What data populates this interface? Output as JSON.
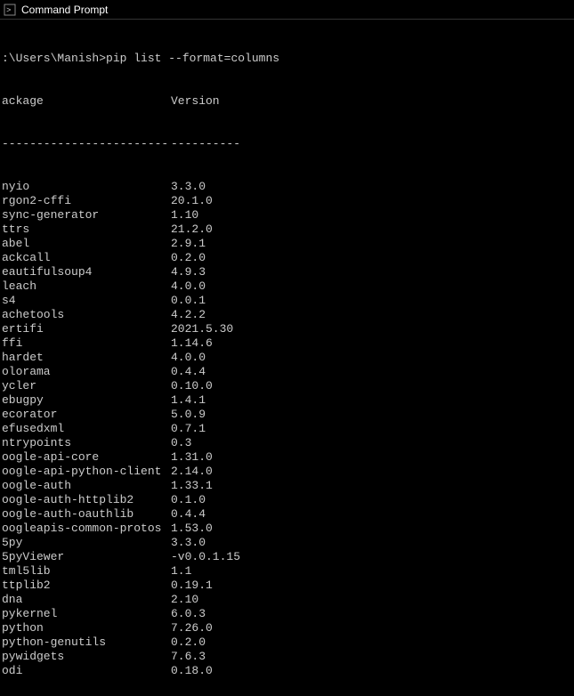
{
  "window": {
    "title": "Command Prompt"
  },
  "prompt": {
    "path": ":\\Users\\Manish>",
    "command": "pip list --format=columns"
  },
  "headers": {
    "package": "ackage",
    "version": "Version"
  },
  "separators": {
    "package": "------------------------",
    "version": "----------"
  },
  "packages": [
    {
      "name": "nyio",
      "version": "3.3.0"
    },
    {
      "name": "rgon2-cffi",
      "version": "20.1.0"
    },
    {
      "name": "sync-generator",
      "version": "1.10"
    },
    {
      "name": "ttrs",
      "version": "21.2.0"
    },
    {
      "name": "abel",
      "version": "2.9.1"
    },
    {
      "name": "ackcall",
      "version": "0.2.0"
    },
    {
      "name": "eautifulsoup4",
      "version": "4.9.3"
    },
    {
      "name": "leach",
      "version": "4.0.0"
    },
    {
      "name": "s4",
      "version": "0.0.1"
    },
    {
      "name": "achetools",
      "version": "4.2.2"
    },
    {
      "name": "ertifi",
      "version": "2021.5.30"
    },
    {
      "name": "ffi",
      "version": "1.14.6"
    },
    {
      "name": "hardet",
      "version": "4.0.0"
    },
    {
      "name": "olorama",
      "version": "0.4.4"
    },
    {
      "name": "ycler",
      "version": "0.10.0"
    },
    {
      "name": "ebugpy",
      "version": "1.4.1"
    },
    {
      "name": "ecorator",
      "version": "5.0.9"
    },
    {
      "name": "efusedxml",
      "version": "0.7.1"
    },
    {
      "name": "ntrypoints",
      "version": "0.3"
    },
    {
      "name": "oogle-api-core",
      "version": "1.31.0"
    },
    {
      "name": "oogle-api-python-client",
      "version": "2.14.0"
    },
    {
      "name": "oogle-auth",
      "version": "1.33.1"
    },
    {
      "name": "oogle-auth-httplib2",
      "version": "0.1.0"
    },
    {
      "name": "oogle-auth-oauthlib",
      "version": "0.4.4"
    },
    {
      "name": "oogleapis-common-protos",
      "version": "1.53.0"
    },
    {
      "name": "5py",
      "version": "3.3.0"
    },
    {
      "name": "5pyViewer",
      "version": "-v0.0.1.15"
    },
    {
      "name": "tml5lib",
      "version": "1.1"
    },
    {
      "name": "ttplib2",
      "version": "0.19.1"
    },
    {
      "name": "dna",
      "version": "2.10"
    },
    {
      "name": "pykernel",
      "version": "6.0.3"
    },
    {
      "name": "python",
      "version": "7.26.0"
    },
    {
      "name": "python-genutils",
      "version": "0.2.0"
    },
    {
      "name": "pywidgets",
      "version": "7.6.3"
    },
    {
      "name": "odi",
      "version": "0.18.0"
    }
  ]
}
